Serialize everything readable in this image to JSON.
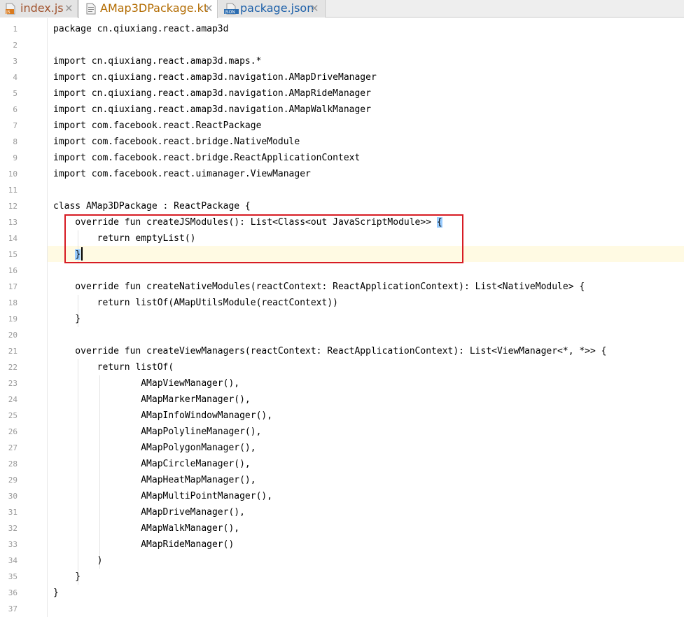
{
  "tabs": [
    {
      "label": "index.js",
      "icon": "js-file-icon",
      "icon_text": "JS",
      "active": false,
      "color": "#a0522d"
    },
    {
      "label": "AMap3DPackage.kt",
      "icon": "kotlin-file-icon",
      "icon_text": "",
      "active": true,
      "color": "#b26b00"
    },
    {
      "label": "package.json",
      "icon": "json-file-icon",
      "icon_text": "JSON",
      "active": false,
      "color": "#1a5ea8"
    }
  ],
  "tab_close_glyph": "✕",
  "editor": {
    "line_numbers": [
      "1",
      "2",
      "3",
      "4",
      "5",
      "6",
      "7",
      "8",
      "9",
      "10",
      "11",
      "12",
      "13",
      "14",
      "15",
      "16",
      "17",
      "18",
      "19",
      "20",
      "21",
      "22",
      "23",
      "24",
      "25",
      "26",
      "27",
      "28",
      "29",
      "30",
      "31",
      "32",
      "33",
      "34",
      "35",
      "36",
      "37"
    ],
    "lines": [
      "package cn.qiuxiang.react.amap3d",
      "",
      "import cn.qiuxiang.react.amap3d.maps.*",
      "import cn.qiuxiang.react.amap3d.navigation.AMapDriveManager",
      "import cn.qiuxiang.react.amap3d.navigation.AMapRideManager",
      "import cn.qiuxiang.react.amap3d.navigation.AMapWalkManager",
      "import com.facebook.react.ReactPackage",
      "import com.facebook.react.bridge.NativeModule",
      "import com.facebook.react.bridge.ReactApplicationContext",
      "import com.facebook.react.uimanager.ViewManager",
      "",
      "class AMap3DPackage : ReactPackage {",
      "    override fun createJSModules(): List<Class<out JavaScriptModule>> ",
      "        return emptyList()",
      "    ",
      "",
      "    override fun createNativeModules(reactContext: ReactApplicationContext): List<NativeModule> {",
      "        return listOf(AMapUtilsModule(reactContext))",
      "    }",
      "",
      "    override fun createViewManagers(reactContext: ReactApplicationContext): List<ViewManager<*, *>> {",
      "        return listOf(",
      "                AMapViewManager(),",
      "                AMapMarkerManager(),",
      "                AMapInfoWindowManager(),",
      "                AMapPolylineManager(),",
      "                AMapPolygonManager(),",
      "                AMapCircleManager(),",
      "                AMapHeatMapManager(),",
      "                AMapMultiPointManager(),",
      "                AMapDriveManager(),",
      "                AMapWalkManager(),",
      "                AMapRideManager()",
      "        )",
      "    }",
      "}",
      ""
    ],
    "matched_open_brace": "{",
    "matched_close_brace": "}",
    "highlight_box_color": "#d71c24",
    "brace_highlight_color": "#99ccff",
    "current_line_color": "#fffae3"
  }
}
